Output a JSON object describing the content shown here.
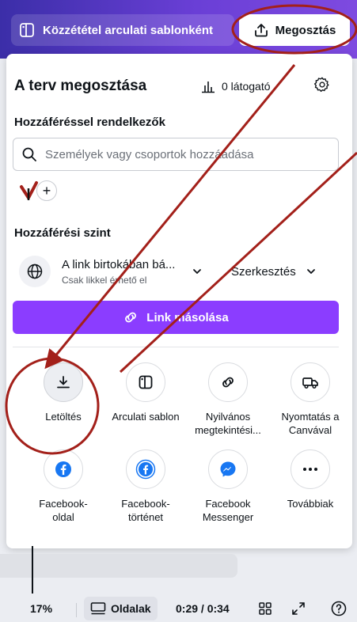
{
  "topbar": {
    "template_label": "Közzététel arculati sablonként",
    "share_label": "Megosztás"
  },
  "panel": {
    "title": "A terv megosztása",
    "visitors": "0 látogató",
    "access_heading": "Hozzáféréssel rendelkezők",
    "search_placeholder": "Személyek vagy csoportok hozzáadása",
    "level_heading": "Hozzáférési szint",
    "link_main": "A link birtokában bá...",
    "link_sub": "Csak likkel érhető el",
    "permission": "Szerkesztés",
    "copy_label": "Link másolása"
  },
  "options": [
    {
      "icon": "download-icon",
      "lines": [
        "Letöltés"
      ]
    },
    {
      "icon": "brand-template-icon",
      "lines": [
        "Arculati sablon"
      ]
    },
    {
      "icon": "link-icon",
      "lines": [
        "Nyilvános",
        "megtekintési..."
      ]
    },
    {
      "icon": "truck-icon",
      "lines": [
        "Nyomtatás a",
        "Canvával"
      ]
    },
    {
      "icon": "facebook-icon",
      "lines": [
        "Facebook-",
        "oldal"
      ]
    },
    {
      "icon": "facebook-story-icon",
      "lines": [
        "Facebook-",
        "történet"
      ]
    },
    {
      "icon": "messenger-icon",
      "lines": [
        "Facebook",
        "Messenger"
      ]
    },
    {
      "icon": "more-icon",
      "lines": [
        "Továbbiak"
      ]
    }
  ],
  "status": {
    "zoom": "17%",
    "pages": "Oldalak",
    "time": "0:29 / 0:34"
  },
  "colors": {
    "accent": "#8b3dff",
    "annotation": "#a3201a",
    "facebook": "#1877f2"
  }
}
